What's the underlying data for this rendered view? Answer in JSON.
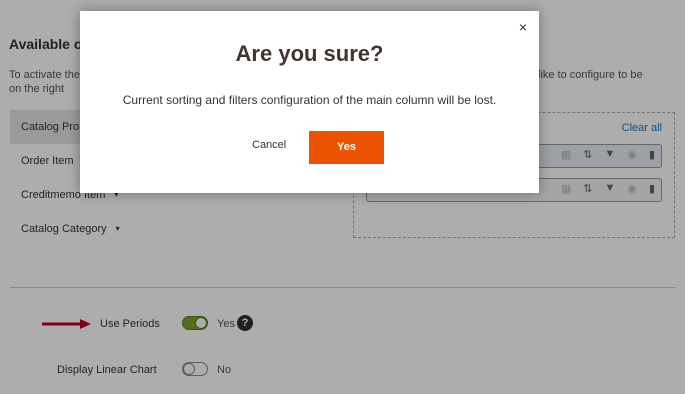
{
  "background": {
    "section_title": "Available o",
    "hint_left": "To activate the on the right",
    "hint_right": "like to configure to be",
    "entities": [
      {
        "label": "Catalog Pro",
        "caret": ""
      },
      {
        "label": "Order Item",
        "caret": ""
      },
      {
        "label": "Creditmemo Item",
        "caret": "▾"
      },
      {
        "label": "Catalog Category",
        "caret": "▾"
      }
    ],
    "clear_all": "Clear all",
    "column_rows": [
      {
        "label": ""
      },
      {
        "label": "\""
      }
    ],
    "use_periods": {
      "label": "Use Periods",
      "value": "Yes",
      "state": "on"
    },
    "display_linear_chart": {
      "label": "Display Linear Chart",
      "value": "No",
      "state": "off"
    },
    "help_glyph": "?"
  },
  "modal": {
    "close_glyph": "×",
    "title": "Are you sure?",
    "message": "Current sorting and filters configuration of the main column will be lost.",
    "cancel_label": "Cancel",
    "confirm_label": "Yes"
  },
  "colors": {
    "accent": "#eb5202",
    "toggle_on": "#79a22e",
    "link": "#1979c3",
    "arrow": "#c0001a"
  }
}
